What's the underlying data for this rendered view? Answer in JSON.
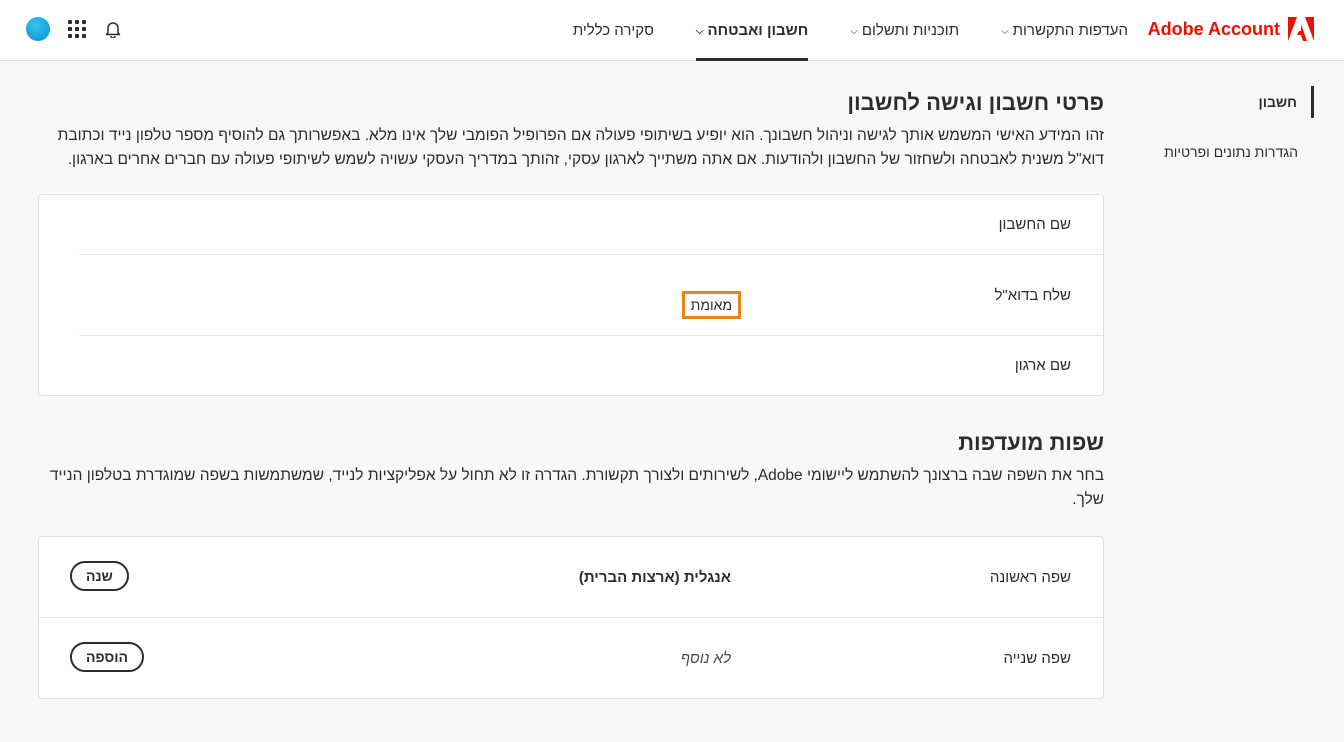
{
  "brand": {
    "name": "Adobe Account"
  },
  "nav": [
    {
      "label": "סקירה כללית",
      "active": false,
      "dropdown": false
    },
    {
      "label": "חשבון ואבטחה",
      "active": true,
      "dropdown": true
    },
    {
      "label": "תוכניות ותשלום",
      "active": false,
      "dropdown": true
    },
    {
      "label": "העדפות התקשרות",
      "active": false,
      "dropdown": true
    }
  ],
  "sidebar": {
    "items": [
      {
        "label": "חשבון",
        "active": true
      },
      {
        "label": "הגדרות נתונים ופרטיות",
        "active": false
      }
    ]
  },
  "account": {
    "title": "פרטי חשבון וגישה לחשבון",
    "description": "זהו המידע האישי המשמש אותך לגישה וניהול חשבונך. הוא יופיע בשיתופי פעולה אם הפרופיל הפומבי שלך אינו מלא. באפשרותך גם להוסיף מספר טלפון נייד וכתובת דוא\"ל משנית לאבטחה ולשחזור של החשבון ולהודעות. אם אתה משתייך לארגון עסקי, זהותך במדריך העסקי עשויה לשמש לשיתופי פעולה עם חברים אחרים בארגון.",
    "rows": [
      {
        "label": "שם החשבון"
      },
      {
        "label": "שלח בדוא\"ל",
        "badge": "מאומת"
      },
      {
        "label": "שם ארגון"
      }
    ]
  },
  "languages": {
    "title": "שפות מועדפות",
    "description": "בחר את השפה שבה ברצונך להשתמש ליישומי Adobe, לשירותים ולצורך תקשורת. הגדרה זו לא תחול על אפליקציות לנייד, שמשתמשות בשפה שמוגדרת בטלפון הנייד שלך.",
    "primary": {
      "label": "שפה ראשונה",
      "value": "אנגלית (ארצות הברית)",
      "button": "שנה"
    },
    "secondary": {
      "label": "שפה שנייה",
      "value": "לא נוסף",
      "button": "הוספה"
    }
  },
  "colors": {
    "accent": "#eb1000",
    "verified_outline": "#e68619",
    "avatar": "#1fa3e8"
  }
}
